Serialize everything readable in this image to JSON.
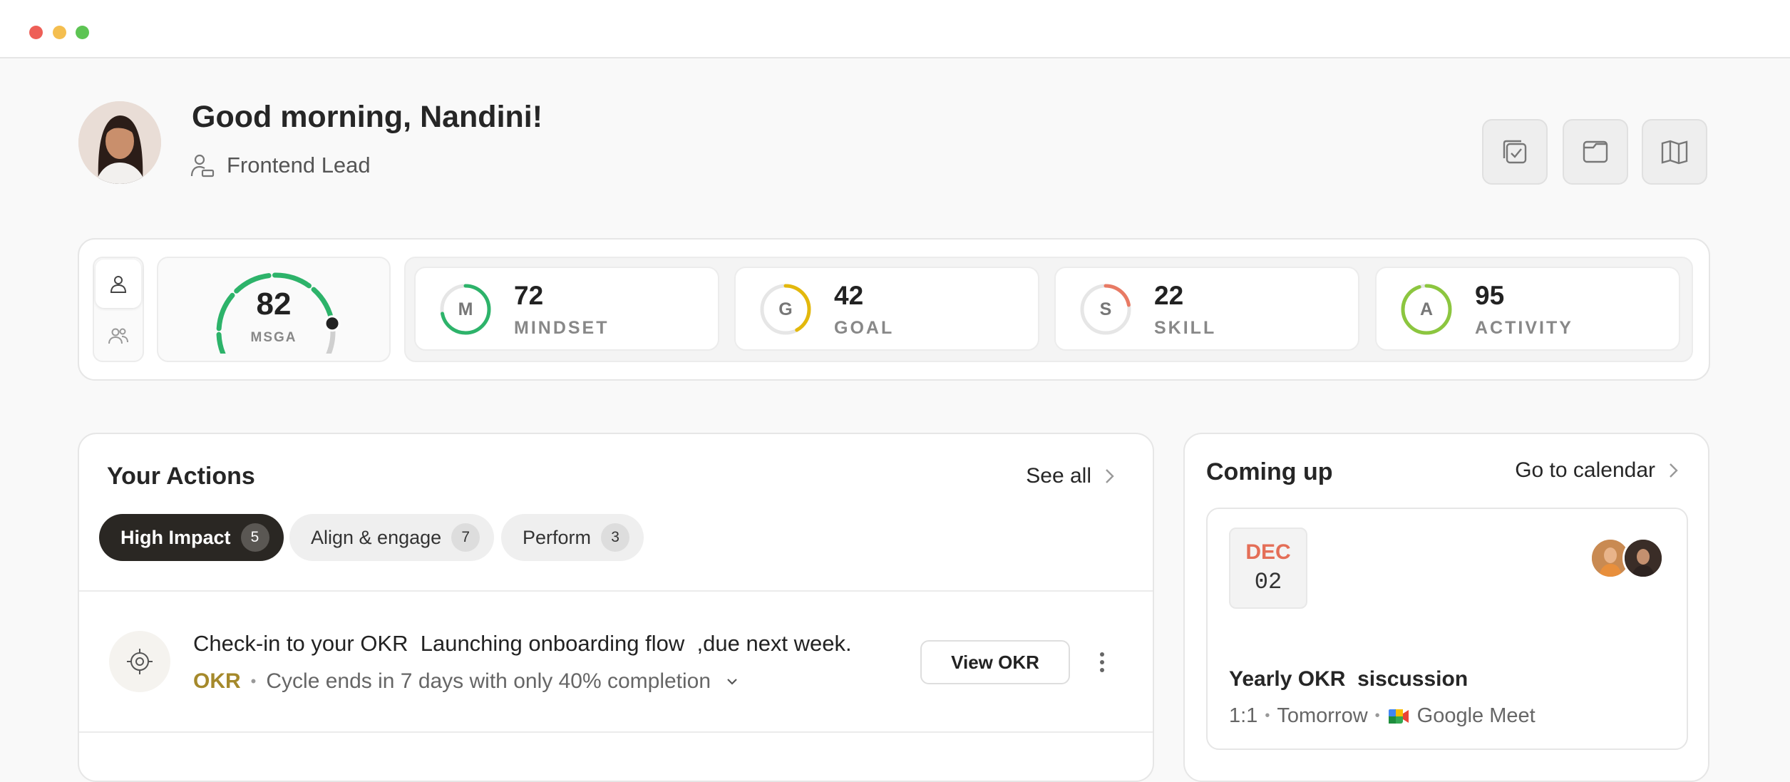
{
  "header": {
    "greeting": "Good morning, Nandini!",
    "role": "Frontend Lead",
    "tools": [
      "tasks-icon",
      "folder-icon",
      "book-icon"
    ]
  },
  "scores": {
    "msga": {
      "value": "82",
      "label": "MSGA",
      "fraction": 0.82,
      "color": "#2db36a"
    },
    "metrics": [
      {
        "letter": "M",
        "value": "72",
        "label": "MINDSET",
        "fraction": 0.72,
        "color": "#2db36a"
      },
      {
        "letter": "G",
        "value": "42",
        "label": "GOAL",
        "fraction": 0.42,
        "color": "#e3b80c"
      },
      {
        "letter": "S",
        "value": "22",
        "label": "SKILL",
        "fraction": 0.22,
        "color": "#e87a64"
      },
      {
        "letter": "A",
        "value": "95",
        "label": "ACTIVITY",
        "fraction": 0.95,
        "color": "#8cc63f"
      }
    ]
  },
  "actions": {
    "title": "Your Actions",
    "see_all": "See all",
    "tabs": [
      {
        "label": "High Impact",
        "count": "5",
        "active": true
      },
      {
        "label": "Align & engage",
        "count": "7",
        "active": false
      },
      {
        "label": "Perform",
        "count": "3",
        "active": false
      }
    ],
    "item": {
      "title": "Check-in to your OKR  Launching onboarding flow  ,due next week.",
      "tag": "OKR",
      "subtitle": "Cycle ends in 7 days with only 40% completion",
      "button": "View OKR"
    }
  },
  "upcoming": {
    "title": "Coming up",
    "go_calendar": "Go to calendar",
    "event": {
      "month": "DEC",
      "day": "02",
      "title": "Yearly OKR  siscussion",
      "type": "1:1",
      "when": "Tomorrow",
      "platform": "Google Meet"
    }
  },
  "colors": {
    "accent_dark": "#2a2723",
    "okr_tag": "#a5892b",
    "date_month": "#e46e57"
  }
}
